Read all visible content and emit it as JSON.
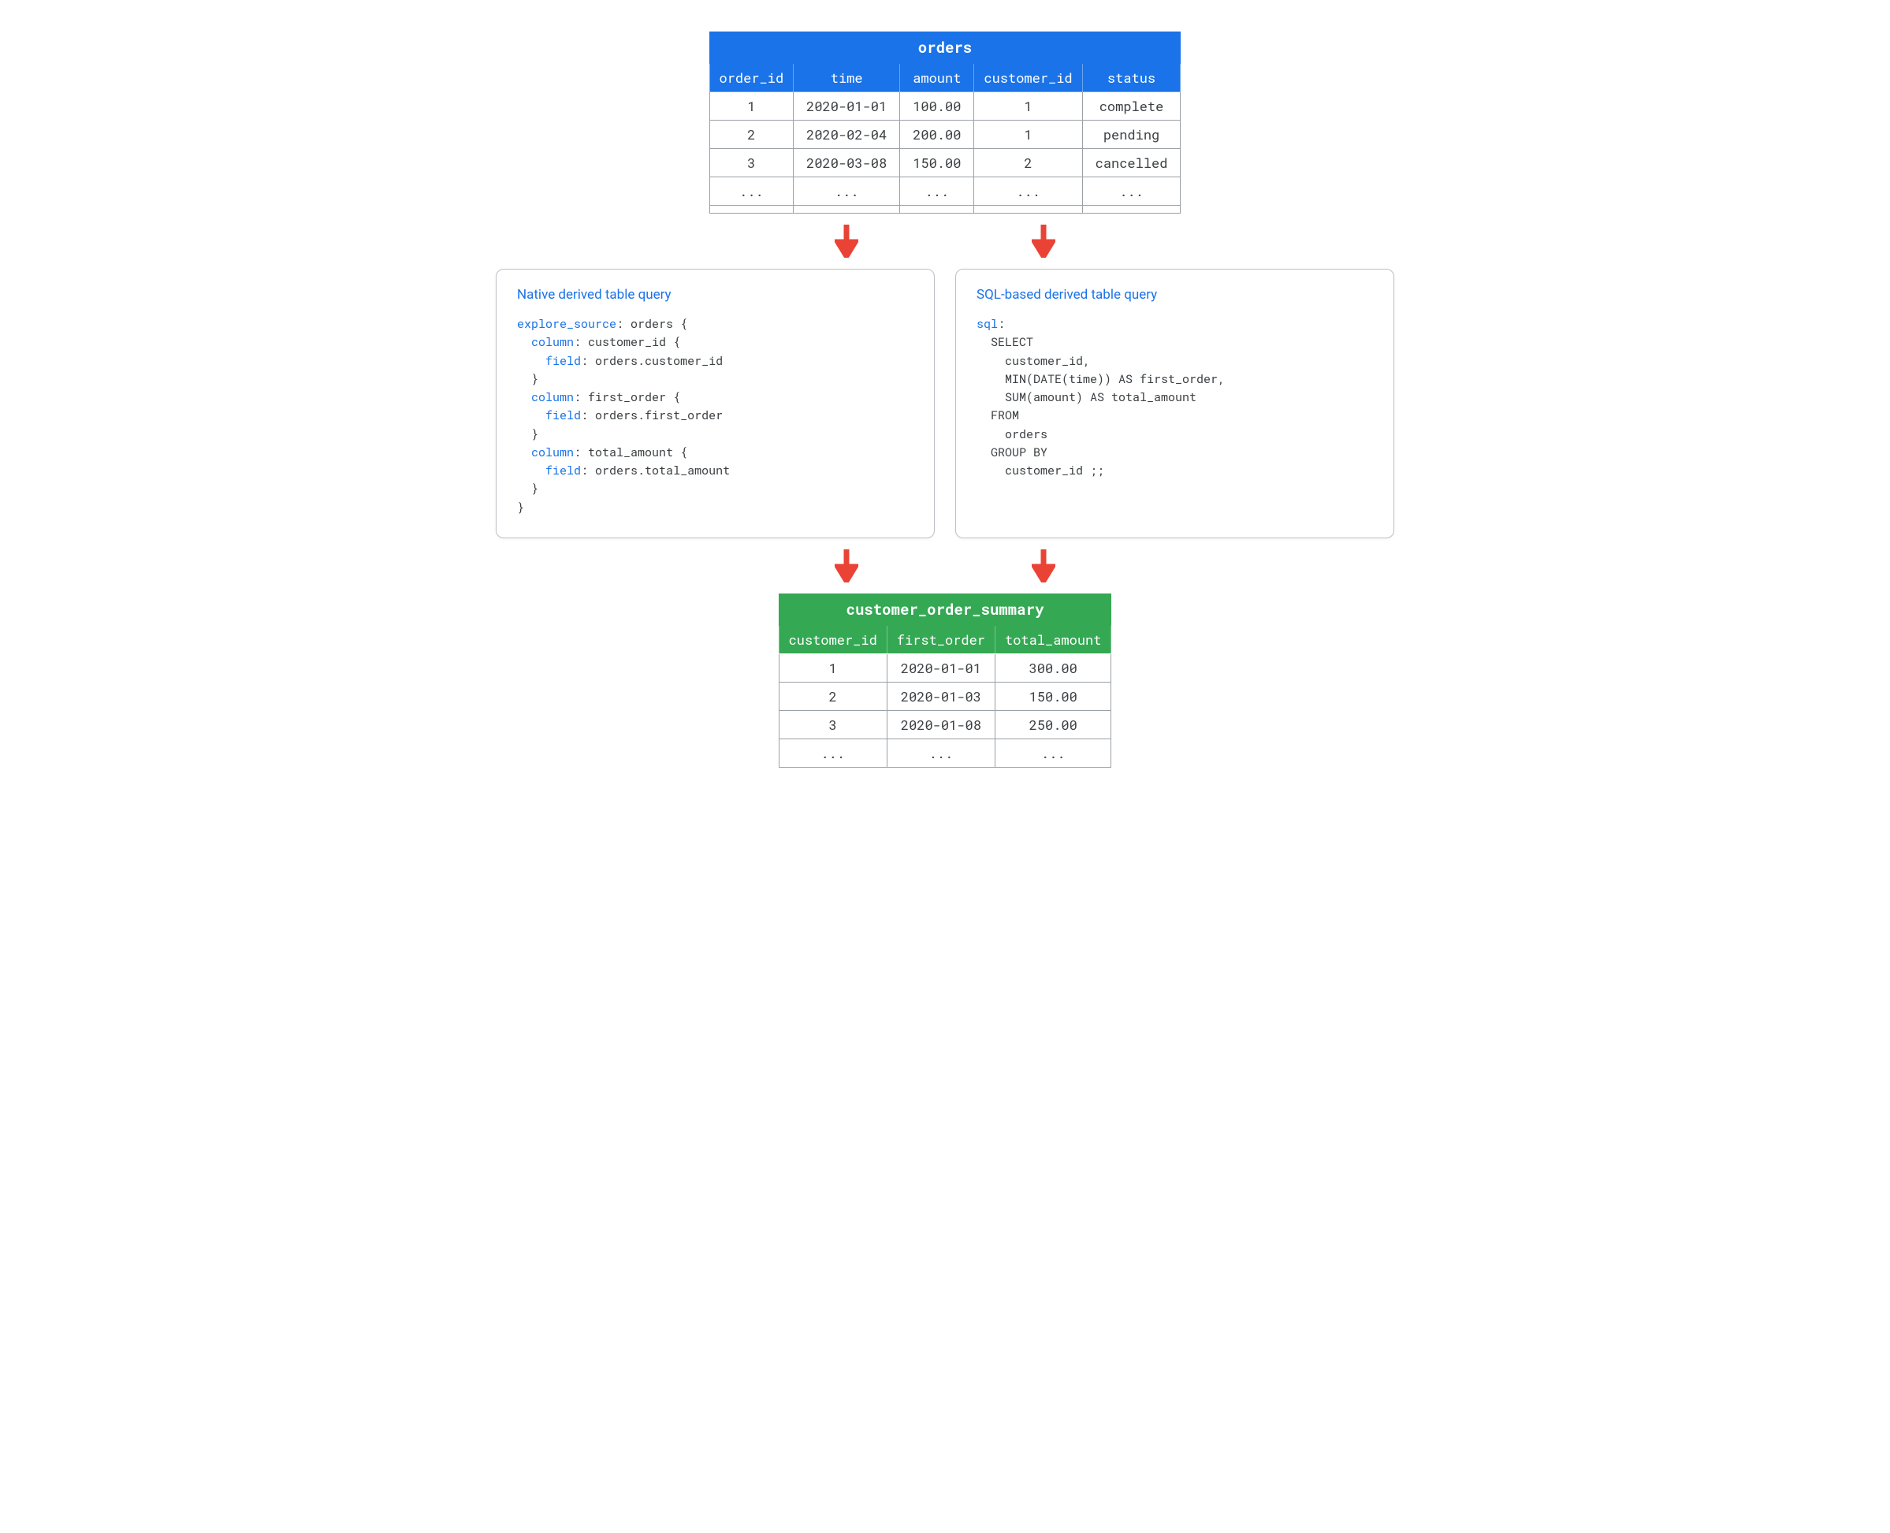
{
  "colors": {
    "blue": "#1a73e8",
    "green": "#34a853",
    "arrow": "#ea4335"
  },
  "orders_table": {
    "title": "orders",
    "columns": [
      "order_id",
      "time",
      "amount",
      "customer_id",
      "status"
    ],
    "rows": [
      [
        "1",
        "2020-01-01",
        "100.00",
        "1",
        "complete"
      ],
      [
        "2",
        "2020-02-04",
        "200.00",
        "1",
        "pending"
      ],
      [
        "3",
        "2020-03-08",
        "150.00",
        "2",
        "cancelled"
      ],
      [
        "...",
        "...",
        "...",
        "...",
        "..."
      ]
    ]
  },
  "native_panel": {
    "title": "Native derived table query",
    "code": {
      "kw_explore_source": "explore_source",
      "explore_name": "orders",
      "kw_column": "column",
      "kw_field": "field",
      "col1_name": "customer_id",
      "col1_field": "orders.customer_id",
      "col2_name": "first_order",
      "col2_field": "orders.first_order",
      "col3_name": "total_amount",
      "col3_field": "orders.total_amount"
    }
  },
  "sql_panel": {
    "title": "SQL-based derived table query",
    "code": {
      "kw_sql": "sql",
      "line_select": "SELECT",
      "line_col1": "customer_id,",
      "line_col2": "MIN(DATE(time)) AS first_order,",
      "line_col3": "SUM(amount) AS total_amount",
      "line_from": "FROM",
      "line_from_table": "orders",
      "line_groupby": "GROUP BY",
      "line_groupby_col": "customer_id ;;"
    }
  },
  "summary_table": {
    "title": "customer_order_summary",
    "columns": [
      "customer_id",
      "first_order",
      "total_amount"
    ],
    "rows": [
      [
        "1",
        "2020-01-01",
        "300.00"
      ],
      [
        "2",
        "2020-01-03",
        "150.00"
      ],
      [
        "3",
        "2020-01-08",
        "250.00"
      ],
      [
        "...",
        "...",
        "..."
      ]
    ]
  }
}
